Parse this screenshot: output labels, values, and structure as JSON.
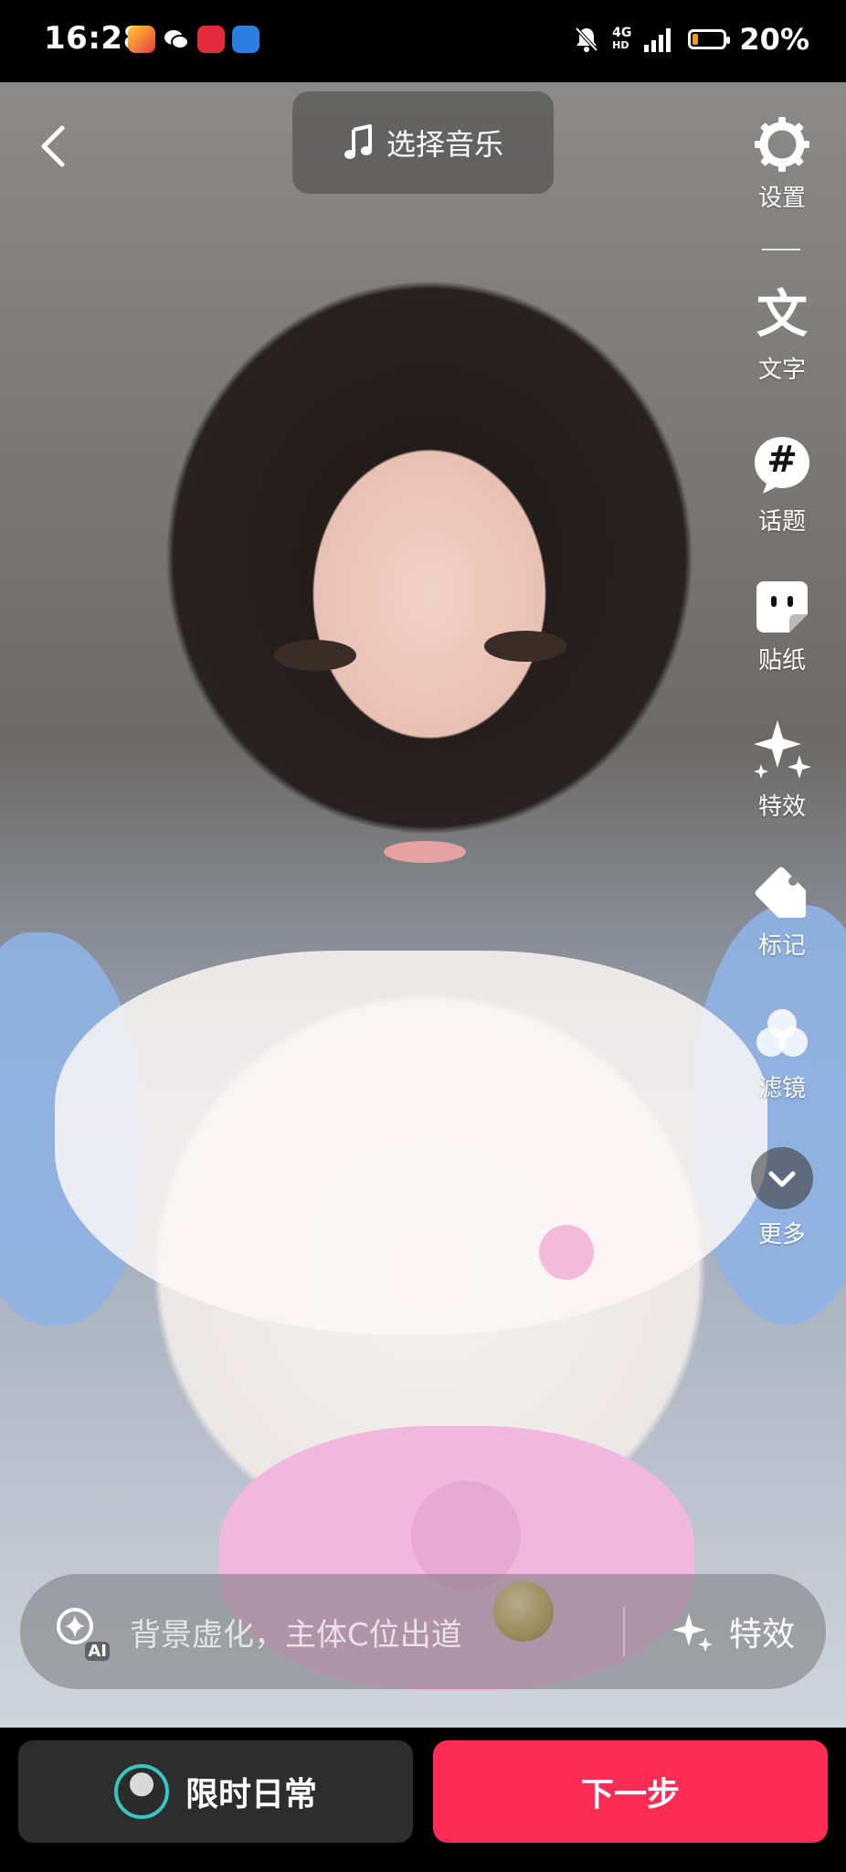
{
  "status_bar": {
    "time": "16:28",
    "network_top": "4G",
    "network_bottom": "HD",
    "battery_text": "20%",
    "battery_level": 0.2,
    "apps": [
      "app-icon-game",
      "wechat-icon",
      "app-icon-red",
      "app-icon-blue"
    ]
  },
  "top": {
    "music_label": "选择音乐"
  },
  "tools": [
    {
      "label": "设置"
    },
    {
      "label": "文字",
      "glyph": "文"
    },
    {
      "label": "话题",
      "glyph": "#"
    },
    {
      "label": "贴纸"
    },
    {
      "label": "特效"
    },
    {
      "label": "标记"
    },
    {
      "label": "滤镜"
    },
    {
      "label": "更多"
    }
  ],
  "suggestion": {
    "ai_label": "AI",
    "text": "背景虚化，主体C位出道",
    "effect_label": "特效"
  },
  "bottom": {
    "daily_label": "限时日常",
    "next_label": "下一步"
  },
  "colors": {
    "accent": "#fe2c55",
    "dark_button": "#2d2d2d"
  }
}
